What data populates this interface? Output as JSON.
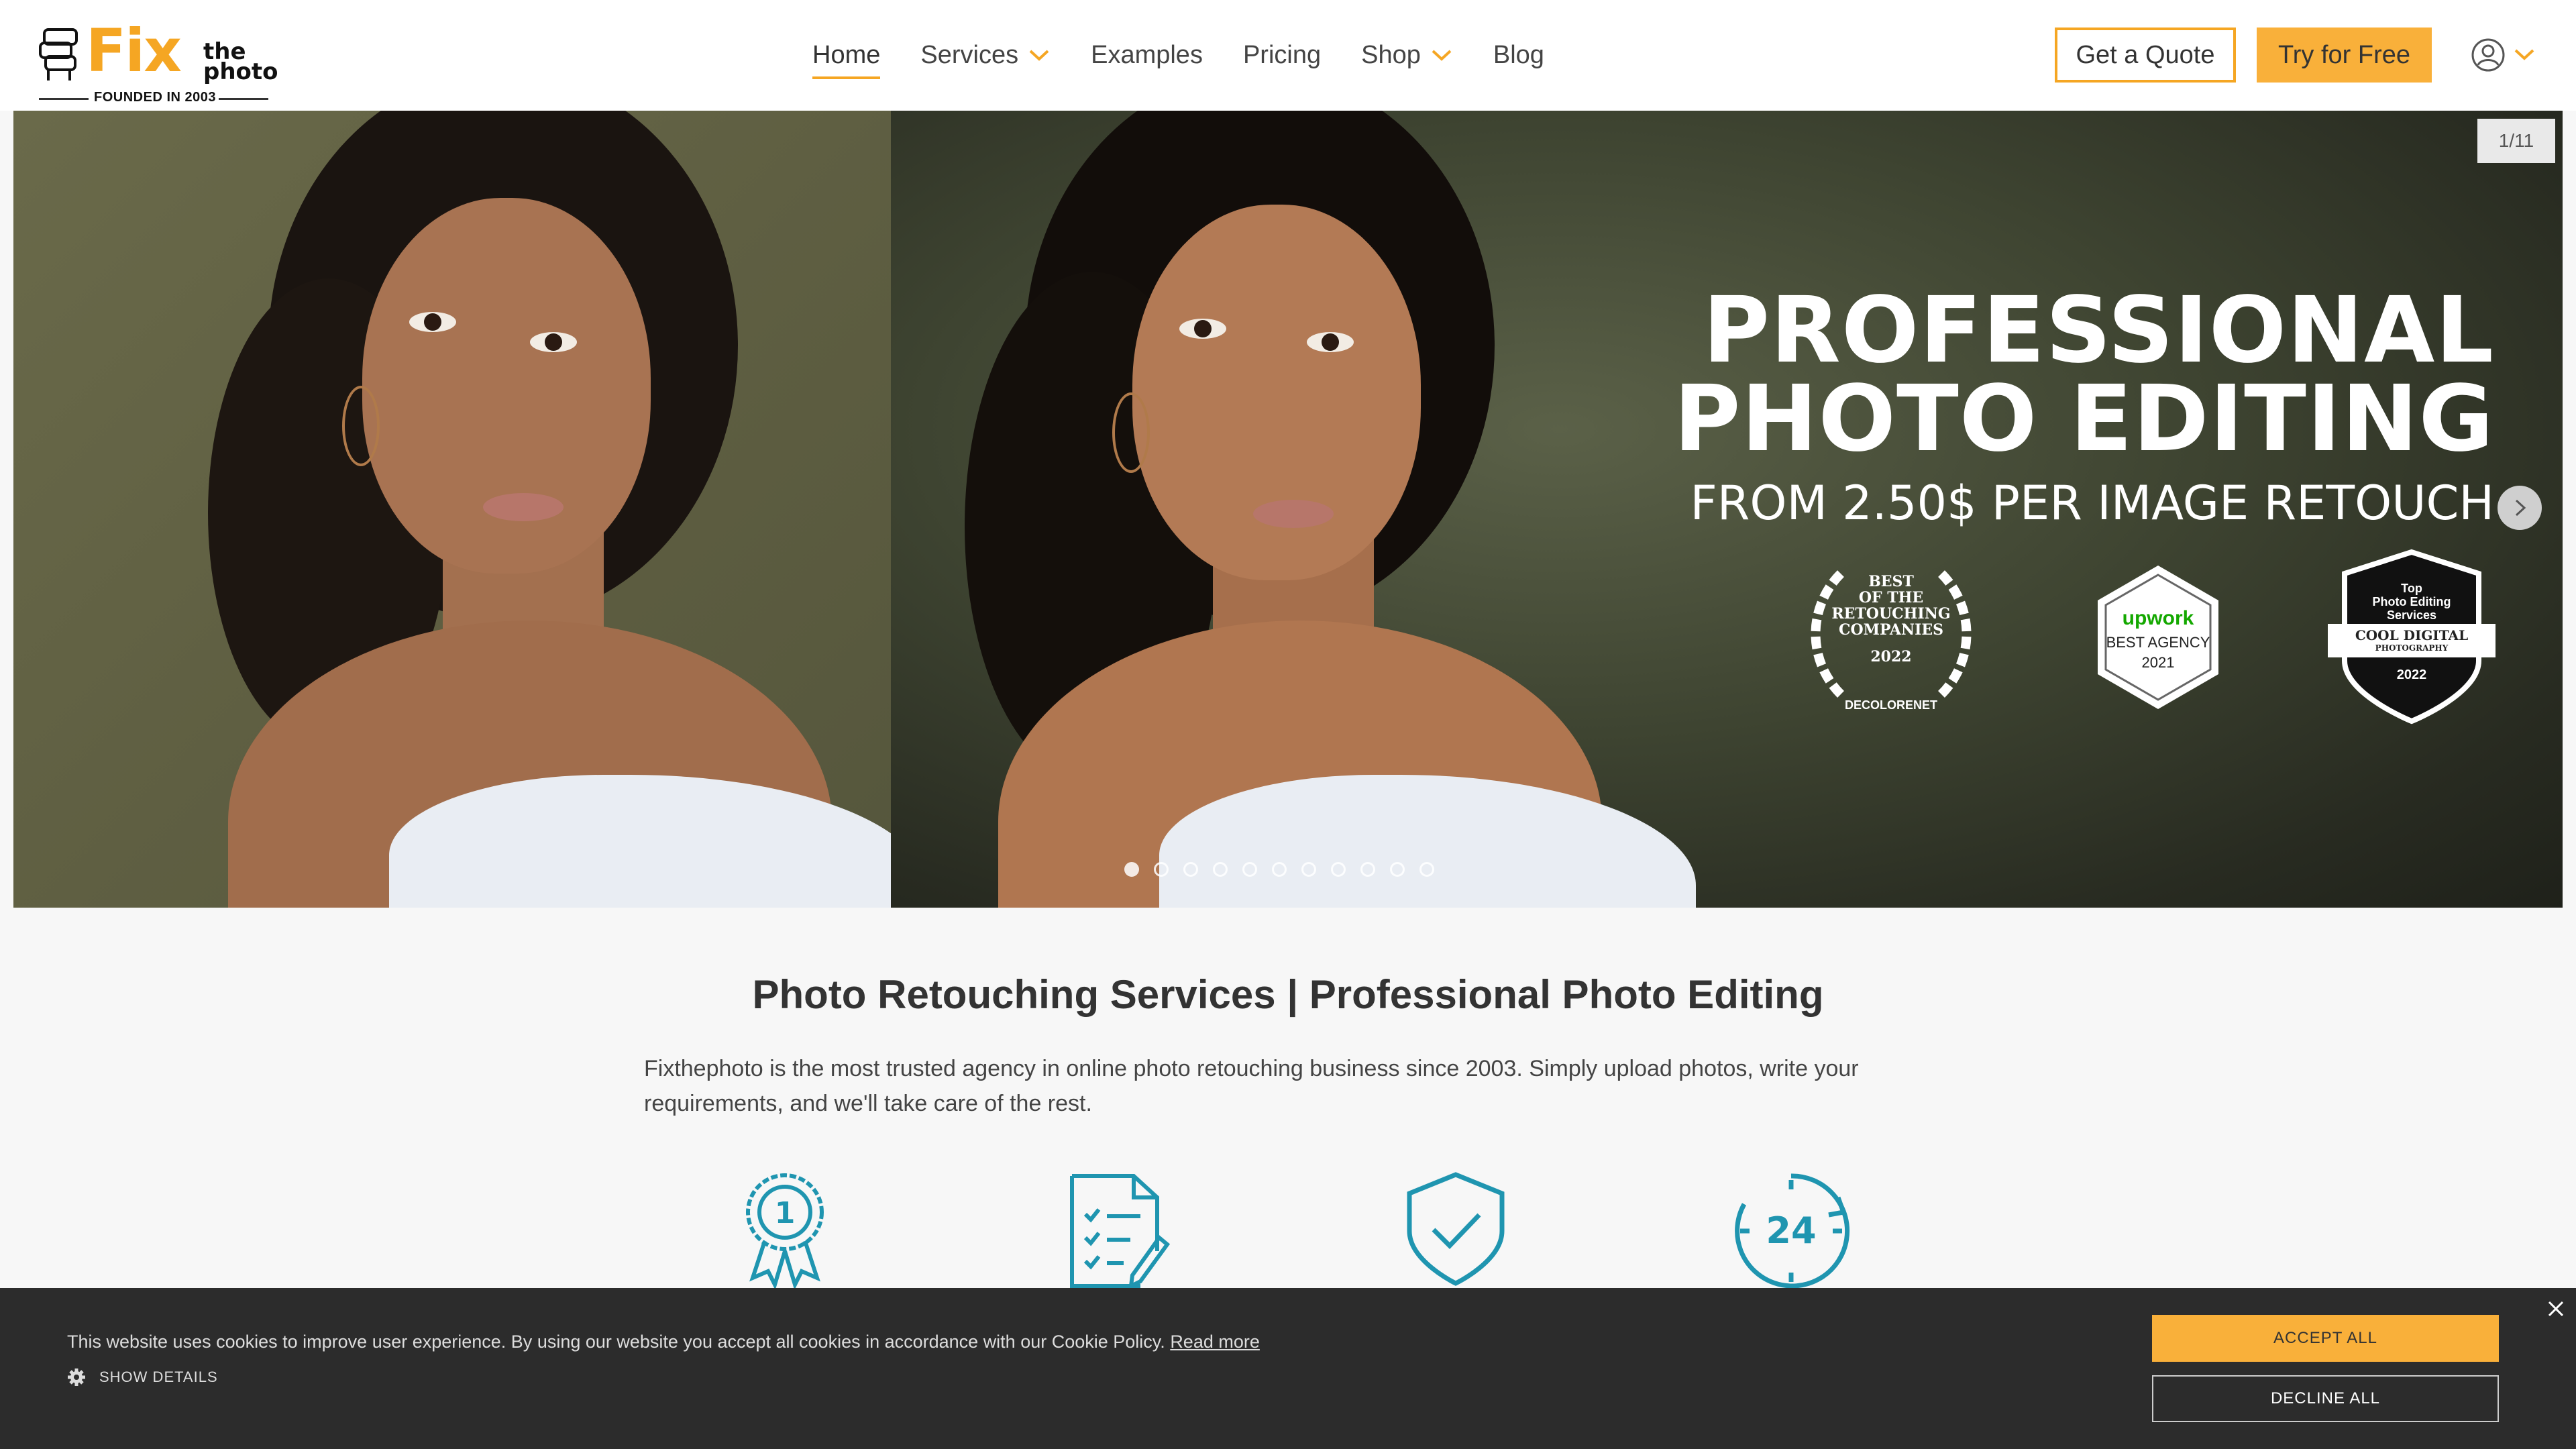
{
  "logo": {
    "brand_fix": "Fix",
    "brand_the": "the",
    "brand_photo": "photo",
    "tagline": "FOUNDED IN 2003"
  },
  "nav": {
    "items": [
      {
        "label": "Home",
        "active": true,
        "dropdown": false
      },
      {
        "label": "Services",
        "active": false,
        "dropdown": true
      },
      {
        "label": "Examples",
        "active": false,
        "dropdown": false
      },
      {
        "label": "Pricing",
        "active": false,
        "dropdown": false
      },
      {
        "label": "Shop",
        "active": false,
        "dropdown": true
      },
      {
        "label": "Blog",
        "active": false,
        "dropdown": false
      }
    ],
    "quote_label": "Get a Quote",
    "try_label": "Try for Free",
    "accent": "#f5a623"
  },
  "hero": {
    "counter": "1/11",
    "headline_1": "PROFESSIONAL",
    "headline_2": "PHOTO EDITING",
    "headline_3": "FROM 2.50$ PER IMAGE RETOUCH",
    "badges": {
      "b1_l1": "BEST",
      "b1_l2": "OF THE",
      "b1_l3": "RETOUCHING",
      "b1_l4": "COMPANIES",
      "b1_year": "2022",
      "b1_brand": "DECOLORENET",
      "b2_brand": "upwork",
      "b2_l1": "BEST AGENCY",
      "b2_year": "2021",
      "b3_l1": "Top",
      "b3_l2": "Photo Editing",
      "b3_l3": "Services",
      "b3_brand": "COOL DIGITAL",
      "b3_sub": "PHOTOGRAPHY",
      "b3_year": "2022"
    },
    "slide_count": 11,
    "active_slide": 1
  },
  "content": {
    "title": "Photo Retouching Services | Professional Photo Editing",
    "intro": "Fixthephoto is the most trusted agency in online photo retouching business since 2003. Simply upload photos, write your requirements, and we'll take care of the rest.",
    "feature_icons": [
      "award-ribbon-icon",
      "checklist-document-icon",
      "shield-check-icon",
      "clock-24-icon"
    ],
    "feature_icon_24": "24",
    "feature_icon_1": "1",
    "icon_color": "#1f95b0"
  },
  "cookie": {
    "text": "This website uses cookies to improve user experience. By using our website you accept all cookies in accordance with our Cookie Policy.",
    "read_more": "Read more",
    "show_details": "SHOW DETAILS",
    "accept": "ACCEPT ALL",
    "decline": "DECLINE ALL"
  }
}
